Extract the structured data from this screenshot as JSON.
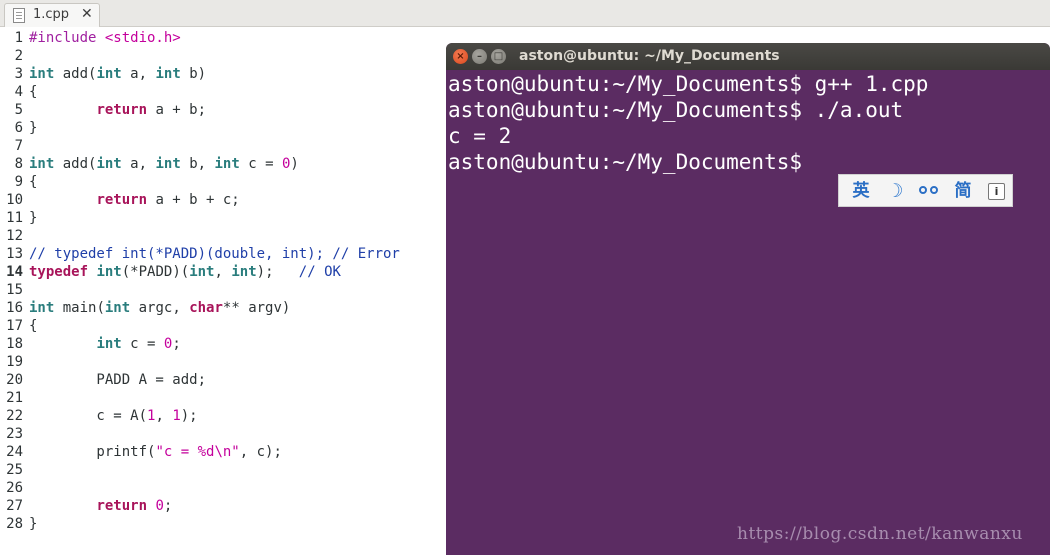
{
  "editor": {
    "tab": {
      "label": "1.cpp",
      "close_glyph": "✕",
      "icon": "text-file-icon"
    },
    "lines": [
      {
        "n": "1",
        "tokens": [
          {
            "t": "#include ",
            "c": "pp"
          },
          {
            "t": "<stdio.h>",
            "c": "str"
          }
        ]
      },
      {
        "n": "2",
        "tokens": []
      },
      {
        "n": "3",
        "tokens": [
          {
            "t": "int",
            "c": "kw"
          },
          {
            "t": " add(",
            "c": ""
          },
          {
            "t": "int",
            "c": "kw"
          },
          {
            "t": " a, ",
            "c": ""
          },
          {
            "t": "int",
            "c": "kw"
          },
          {
            "t": " b)",
            "c": ""
          }
        ]
      },
      {
        "n": "4",
        "tokens": [
          {
            "t": "{",
            "c": ""
          }
        ]
      },
      {
        "n": "5",
        "tokens": [
          {
            "t": "        ",
            "c": ""
          },
          {
            "t": "return",
            "c": "kw2"
          },
          {
            "t": " a + b;",
            "c": ""
          }
        ]
      },
      {
        "n": "6",
        "tokens": [
          {
            "t": "}",
            "c": ""
          }
        ]
      },
      {
        "n": "7",
        "tokens": []
      },
      {
        "n": "8",
        "tokens": [
          {
            "t": "int",
            "c": "kw"
          },
          {
            "t": " add(",
            "c": ""
          },
          {
            "t": "int",
            "c": "kw"
          },
          {
            "t": " a, ",
            "c": ""
          },
          {
            "t": "int",
            "c": "kw"
          },
          {
            "t": " b, ",
            "c": ""
          },
          {
            "t": "int",
            "c": "kw"
          },
          {
            "t": " c = ",
            "c": ""
          },
          {
            "t": "0",
            "c": "num"
          },
          {
            "t": ")",
            "c": ""
          }
        ]
      },
      {
        "n": "9",
        "tokens": [
          {
            "t": "{",
            "c": ""
          }
        ]
      },
      {
        "n": "10",
        "tokens": [
          {
            "t": "        ",
            "c": ""
          },
          {
            "t": "return",
            "c": "kw2"
          },
          {
            "t": " a + b + c;",
            "c": ""
          }
        ]
      },
      {
        "n": "11",
        "tokens": [
          {
            "t": "}",
            "c": ""
          }
        ]
      },
      {
        "n": "12",
        "tokens": []
      },
      {
        "n": "13",
        "tokens": [
          {
            "t": "// typedef int(*PADD)(double, int); // Error",
            "c": "cm"
          }
        ]
      },
      {
        "n": "14",
        "current": true,
        "tokens": [
          {
            "t": "typedef",
            "c": "kw2"
          },
          {
            "t": " ",
            "c": ""
          },
          {
            "t": "int",
            "c": "kw"
          },
          {
            "t": "(*PADD)(",
            "c": ""
          },
          {
            "t": "int",
            "c": "kw"
          },
          {
            "t": ", ",
            "c": ""
          },
          {
            "t": "int",
            "c": "kw"
          },
          {
            "t": ");   ",
            "c": ""
          },
          {
            "t": "// OK",
            "c": "cm"
          }
        ]
      },
      {
        "n": "15",
        "tokens": []
      },
      {
        "n": "16",
        "tokens": [
          {
            "t": "int",
            "c": "kw"
          },
          {
            "t": " main(",
            "c": ""
          },
          {
            "t": "int",
            "c": "kw"
          },
          {
            "t": " argc, ",
            "c": ""
          },
          {
            "t": "char",
            "c": "kw2"
          },
          {
            "t": "** argv)",
            "c": ""
          }
        ]
      },
      {
        "n": "17",
        "tokens": [
          {
            "t": "{",
            "c": ""
          }
        ]
      },
      {
        "n": "18",
        "tokens": [
          {
            "t": "        ",
            "c": ""
          },
          {
            "t": "int",
            "c": "kw"
          },
          {
            "t": " c = ",
            "c": ""
          },
          {
            "t": "0",
            "c": "num"
          },
          {
            "t": ";",
            "c": ""
          }
        ]
      },
      {
        "n": "19",
        "tokens": []
      },
      {
        "n": "20",
        "tokens": [
          {
            "t": "        PADD A = add;",
            "c": ""
          }
        ]
      },
      {
        "n": "21",
        "tokens": []
      },
      {
        "n": "22",
        "tokens": [
          {
            "t": "        c = A(",
            "c": ""
          },
          {
            "t": "1",
            "c": "num"
          },
          {
            "t": ", ",
            "c": ""
          },
          {
            "t": "1",
            "c": "num"
          },
          {
            "t": ");",
            "c": ""
          }
        ]
      },
      {
        "n": "23",
        "tokens": []
      },
      {
        "n": "24",
        "tokens": [
          {
            "t": "        printf(",
            "c": ""
          },
          {
            "t": "\"c = %d\\n\"",
            "c": "str"
          },
          {
            "t": ", c);",
            "c": ""
          }
        ]
      },
      {
        "n": "25",
        "tokens": []
      },
      {
        "n": "26",
        "tokens": []
      },
      {
        "n": "27",
        "tokens": [
          {
            "t": "        ",
            "c": ""
          },
          {
            "t": "return",
            "c": "kw2"
          },
          {
            "t": " ",
            "c": ""
          },
          {
            "t": "0",
            "c": "num"
          },
          {
            "t": ";",
            "c": ""
          }
        ]
      },
      {
        "n": "28",
        "tokens": [
          {
            "t": "}",
            "c": ""
          }
        ]
      }
    ]
  },
  "terminal": {
    "title": "aston@ubuntu: ~/My_Documents",
    "buttons": {
      "close": "×",
      "minimize": "–",
      "maximize": "□"
    },
    "lines": [
      "aston@ubuntu:~/My_Documents$ g++ 1.cpp",
      "aston@ubuntu:~/My_Documents$ ./a.out",
      "c = 2",
      "aston@ubuntu:~/My_Documents$"
    ]
  },
  "ime_toolbar": {
    "lang_label": "英",
    "mode_icon": "crescent-moon-icon",
    "mode_glyph": "☽",
    "punct_icon": "glasses-icon",
    "charset_label": "简",
    "info_label": "i"
  },
  "watermark": "https://blog.csdn.net/kanwanxu"
}
